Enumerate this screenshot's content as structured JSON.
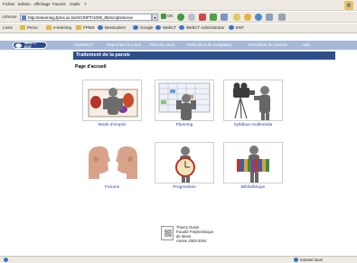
{
  "browser": {
    "menu": [
      "Fichier",
      "Edition",
      "Affichage",
      "Favoris",
      "Outils",
      "?"
    ],
    "address_label": "Adresse",
    "address_value": "http://elearning.fpms.ac.be/SCRIPT/1005_95/scripts/serve",
    "go_label": "OK",
    "links": [
      "Liens",
      "Perso",
      "e-learning",
      "FPMS",
      "Beestudent",
      "Google",
      "WebCT",
      "WebCT Administrator",
      "ENT"
    ],
    "status_zone": "Intranet local"
  },
  "webct": {
    "logo_text": [
      "WEB CT",
      "EDIT"
    ],
    "nav": [
      "myWebCT",
      "Reprendre le cours",
      "Plan du cours",
      "Vérification du navigateur",
      "Formation du courriel",
      "Aide"
    ],
    "section_title": "Traitement de la parole",
    "page_heading": "Page d'accueil",
    "tiles": [
      {
        "label": "Mode d'emploi",
        "icon": "person-chart-icon"
      },
      {
        "label": "Planning",
        "icon": "person-calendar-icon"
      },
      {
        "label": "Syllabus multimédia",
        "icon": "person-camera-icon"
      },
      {
        "label": "Forums",
        "icon": "two-faces-icon"
      },
      {
        "label": "Progression",
        "icon": "person-clock-icon"
      },
      {
        "label": "Bibliothèque",
        "icon": "person-books-icon"
      }
    ],
    "footer": [
      "Thierry Dutoit",
      "Faculté Polytechnique",
      "de Mons",
      "Année 2003-2004"
    ]
  },
  "colors": {
    "nav_bg": "#a7b9d8",
    "section_bg": "#2e4f8e",
    "link": "#2b3fa8"
  }
}
